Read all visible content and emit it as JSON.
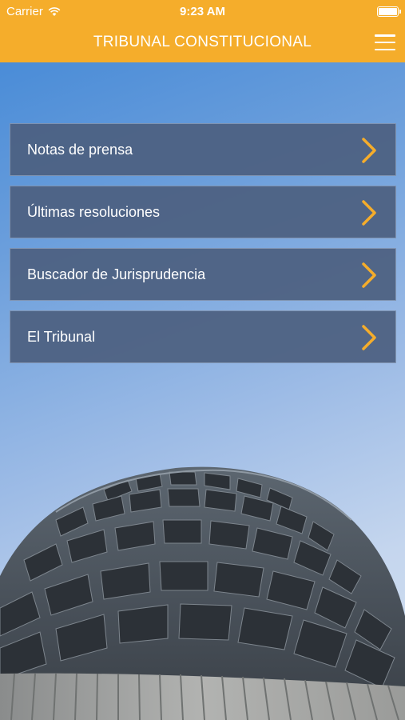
{
  "status_bar": {
    "carrier": "Carrier",
    "time": "9:23 AM",
    "icons": [
      "wifi-icon",
      "battery-icon"
    ]
  },
  "nav": {
    "title": "TRIBUNAL CONSTITUCIONAL",
    "menu_icon": "hamburger-menu-icon"
  },
  "menu": {
    "items": [
      {
        "label": "Notas de prensa"
      },
      {
        "label": "Últimas resoluciones"
      },
      {
        "label": "Buscador de Jurisprudencia"
      },
      {
        "label": "El Tribunal"
      }
    ],
    "chevron_icon": "chevron-right-icon"
  },
  "colors": {
    "header": "#f5ad2b",
    "menu_item_bg": "#4c6080",
    "chevron": "#f5ad2b",
    "text": "#ffffff"
  }
}
